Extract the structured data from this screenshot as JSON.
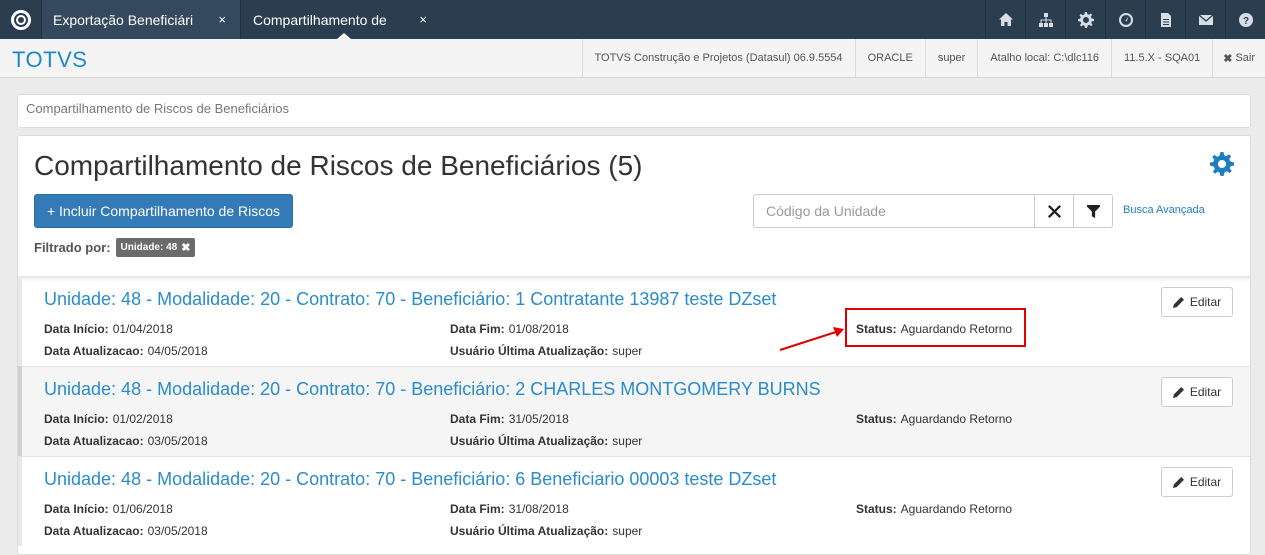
{
  "topbar": {
    "tabs": [
      {
        "label": "Exportação Beneficiári",
        "close": "×"
      },
      {
        "label": "Compartilhamento de",
        "close": "×"
      }
    ],
    "icons": [
      "home-icon",
      "sitemap-icon",
      "gear-icon",
      "dashboard-icon",
      "file-icon",
      "envelope-icon",
      "help-icon"
    ]
  },
  "header": {
    "brand": "TOTVS",
    "company": "TOTVS Construção e Projetos (Datasul) 06.9.5554",
    "db": "ORACLE",
    "user": "super",
    "shortcut": "Atalho local: C:\\dlc116",
    "version": "11.5.X - SQA01",
    "logout": "Sair"
  },
  "breadcrumb": "Compartilhamento de Riscos de Beneficiários",
  "main": {
    "title": "Compartilhamento de Riscos de Beneficiários (5)",
    "add_button": "+ Incluir Compartilhamento de Riscos",
    "search_placeholder": "Código da Unidade",
    "advanced_search": "Busca Avançada",
    "filtered_label": "Filtrado por:",
    "filter_badge": "Unidade: 48"
  },
  "labels": {
    "start": "Data Início:",
    "end": "Data Fim:",
    "status": "Status:",
    "updated": "Data Atualizacao:",
    "updated_by": "Usuário Última Atualização:",
    "edit": "Editar"
  },
  "rows": [
    {
      "title": "Unidade: 48 - Modalidade: 20 - Contrato: 70 - Beneficiário: 1 Contratante 13987 teste DZset",
      "start": "01/04/2018",
      "end": "01/08/2018",
      "status": "Aguardando Retorno",
      "updated": "04/05/2018",
      "updated_by": "super"
    },
    {
      "title": "Unidade: 48 - Modalidade: 20 - Contrato: 70 - Beneficiário: 2 CHARLES MONTGOMERY BURNS",
      "start": "01/02/2018",
      "end": "31/05/2018",
      "status": "Aguardando Retorno",
      "updated": "03/05/2018",
      "updated_by": "super"
    },
    {
      "title": "Unidade: 48 - Modalidade: 20 - Contrato: 70 - Beneficiário: 6 Beneficiario 00003 teste DZset",
      "start": "01/06/2018",
      "end": "31/08/2018",
      "status": "Aguardando Retorno",
      "updated": "03/05/2018",
      "updated_by": "super"
    }
  ],
  "colors": {
    "accent": "#337ab7",
    "link": "#2a8cc9",
    "topbar": "#2b3e50",
    "annotation": "#e00000"
  }
}
